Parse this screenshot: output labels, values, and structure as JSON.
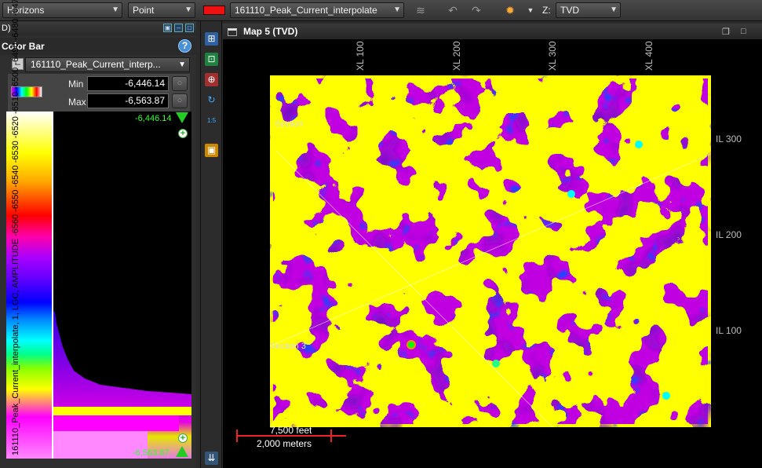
{
  "toolbar": {
    "horizons_combo": "Horizons",
    "point_combo": "Point",
    "color_swatch": "#ee1111",
    "surface_combo": "161110_Peak_Current_interpolate",
    "z_label": "Z:",
    "z_combo": "TVD"
  },
  "left_panel": {
    "header_text": "D)",
    "color_bar_title": "Color Bar",
    "attribute_combo": "161110_Peak_Current_interp...",
    "min_label": "Min",
    "min_value": "-6,446.14",
    "max_label": "Max",
    "max_value": "-6,563.87",
    "top_range_label": "-6,446.14",
    "bottom_range_label": "-6,563.87",
    "vertical_label": "161110_Peak_Current_interpolate, 1, LGC, AMPLITUDE -6560 -6550 -6540 -6530 -6520 -6510 -6500 -6490 -6480 -6470 -6460 -6450"
  },
  "map": {
    "title": "Map 5 (TVD)",
    "xl_labels": [
      "XL 100",
      "XL 200",
      "XL 300",
      "XL 400"
    ],
    "il_labels": [
      "IL 300",
      "IL 200",
      "IL 100"
    ],
    "section_label_top": "Section",
    "section_label_bottom": "Section 3",
    "scale_feet": "7,500 feet",
    "scale_meters": "2,000 meters"
  },
  "colors": {
    "accent_green": "#33dd33",
    "map_magenta": "#c000e0",
    "map_yellow": "#ffff00",
    "map_blue": "#2040ff"
  }
}
